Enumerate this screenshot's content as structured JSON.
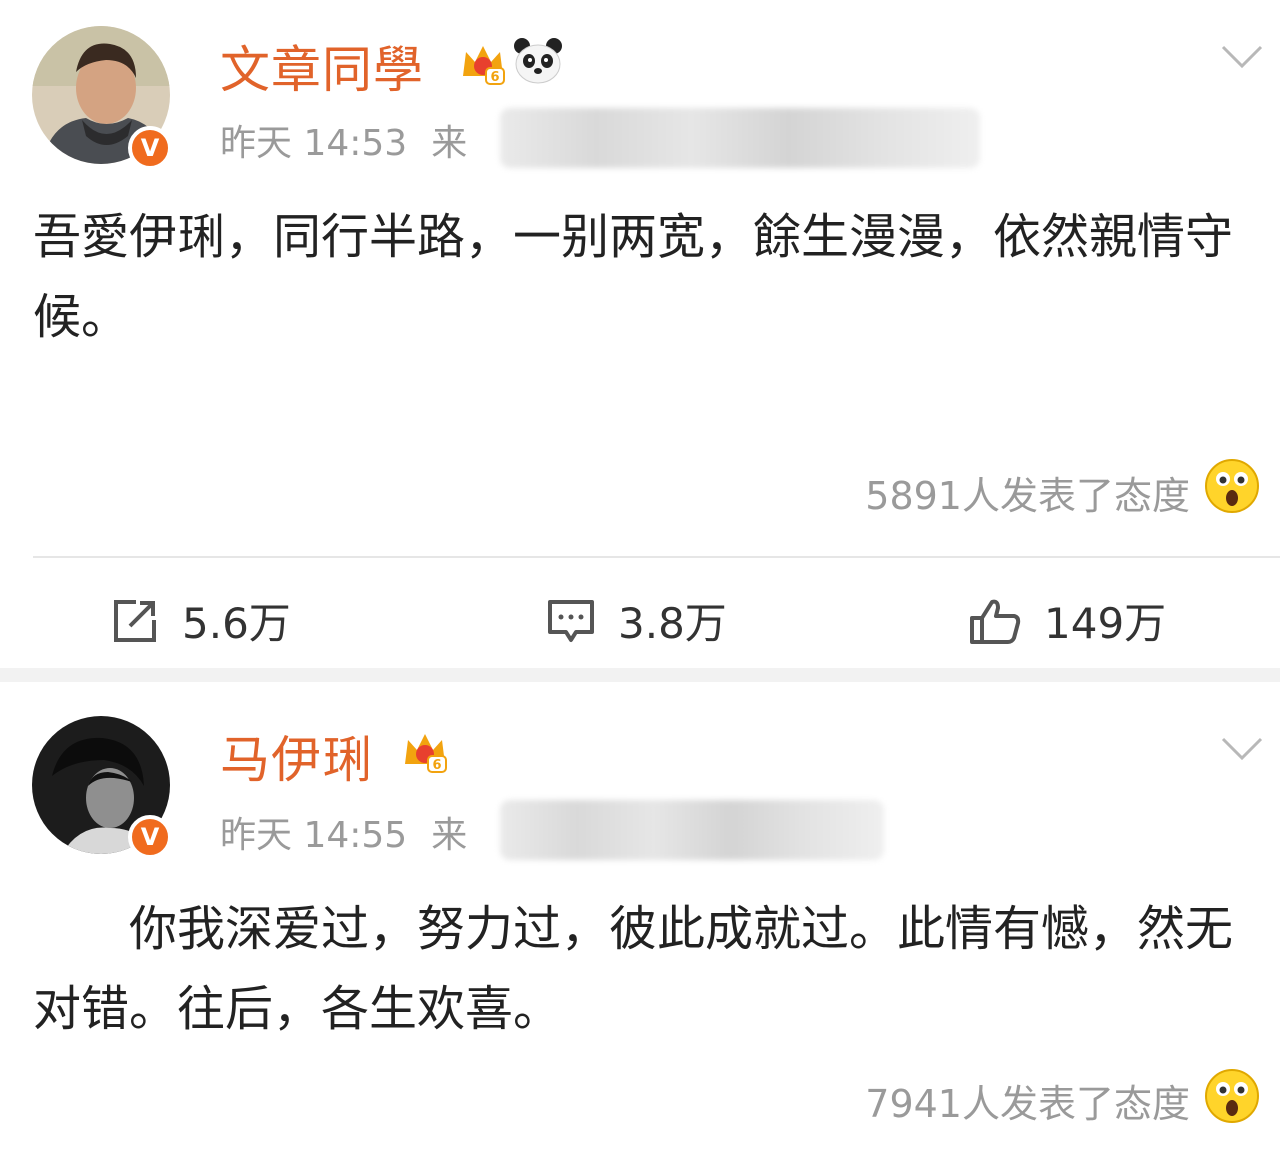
{
  "posts": [
    {
      "username": "文章同學",
      "time": "昨天 14:53",
      "source_prefix": "来",
      "text": "吾愛伊琍，同行半路，一别两宽，餘生漫漫，依然親情守候。",
      "attitude": "5891人发表了态度",
      "actions": {
        "repost": "5.6万",
        "comment": "3.8万",
        "like": "149万"
      },
      "badges": [
        "vip-crown-6",
        "panda-emoji"
      ]
    },
    {
      "username": "马伊琍",
      "time": "昨天 14:55",
      "source_prefix": "来",
      "text": "　　你我深爱过，努力过，彼此成就过。此情有憾，然无对错。往后，各生欢喜。",
      "attitude": "7941人发表了态度",
      "badges": [
        "vip-crown-6"
      ]
    }
  ],
  "icons": {
    "verified": "verified-v-icon",
    "crown": "crown-icon",
    "panda": "panda-icon",
    "chevron": "chevron-down-icon",
    "emoji": "surprised-emoji-icon",
    "repost": "repost-icon",
    "comment": "comment-icon",
    "like": "like-icon"
  },
  "badge_text": {
    "verified": "V",
    "crown_level": "6"
  },
  "colors": {
    "username": "#e1632a",
    "meta": "#9a9a9a",
    "verified": "#f06b1e",
    "crown": "#f2a30f"
  }
}
